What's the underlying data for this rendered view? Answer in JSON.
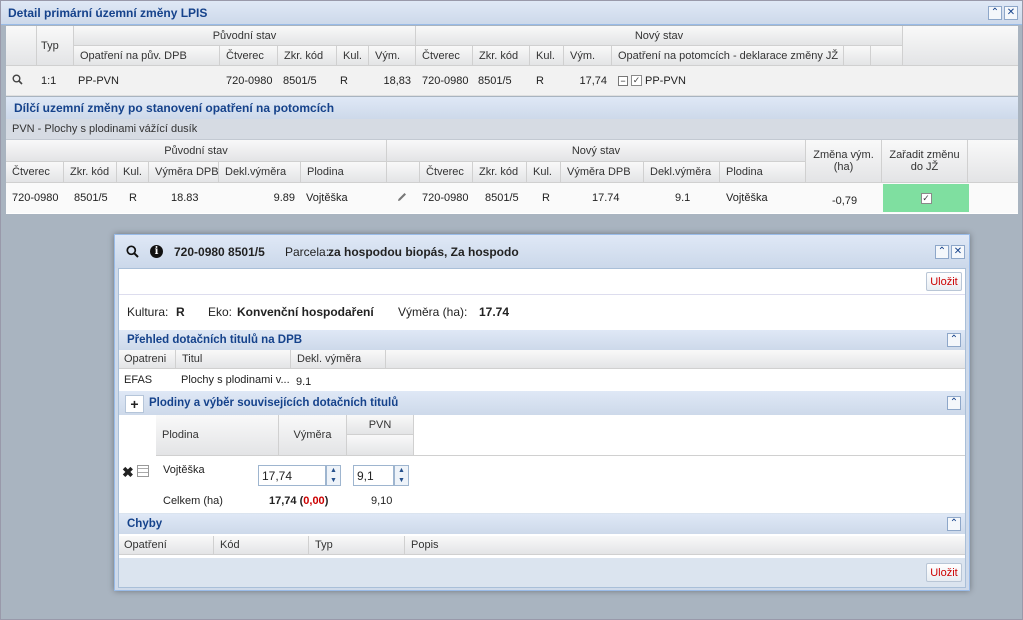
{
  "outer": {
    "title": "Detail primární územní změny LPIS",
    "top_grid": {
      "group_orig": "Původní stav",
      "group_new": "Nový stav",
      "col_typ": "Typ",
      "col_opatreni": "Opatření na pův. DPB",
      "col_ctverec": "Čtverec",
      "col_zkr": "Zkr. kód",
      "col_kul": "Kul.",
      "col_vym": "Vým.",
      "col_ctverec2": "Čtverec",
      "col_zkr2": "Zkr. kód",
      "col_kul2": "Kul.",
      "col_vym2": "Vým.",
      "col_opatreni_potomci": "Opatření na potomcích - deklarace změny JŽ",
      "row": {
        "typ": "1:1",
        "opatreni": "PP-PVN",
        "ctverec": "720-0980",
        "zkr": "8501/5",
        "kul": "R",
        "vym": "18,83",
        "ctverec2": "720-0980",
        "zkr2": "8501/5",
        "kul2": "R",
        "vym2": "17,74",
        "opatreni_potomci": "PP-PVN"
      }
    },
    "section2_title": "Dílčí uzemní změny po stanovení opatření na potomcích",
    "section2_sub": "PVN - Plochy s plodinami vážící dusík",
    "grid2": {
      "group_orig": "Původní stav",
      "group_new": "Nový stav",
      "col_ctverec": "Čtverec",
      "col_zkr": "Zkr. kód",
      "col_kul": "Kul.",
      "col_vymdpb": "Výměra DPB",
      "col_dekl": "Dekl.výměra",
      "col_plodina": "Plodina",
      "col_ctverec2": "Čtverec",
      "col_zkr2": "Zkr. kód",
      "col_kul2": "Kul.",
      "col_vymdpb2": "Výměra DPB",
      "col_dekl2": "Dekl.výměra",
      "col_plodina2": "Plodina",
      "col_zmena_1": "Změna vým.",
      "col_zmena_2": "(ha)",
      "col_zaradit_1": "Zařadit změnu",
      "col_zaradit_2": "do JŽ",
      "row": {
        "ctverec": "720-0980",
        "zkr": "8501/5",
        "kul": "R",
        "vymdpb": "18.83",
        "dekl": "9.89",
        "plodina": "Vojtěška",
        "ctverec2": "720-0980",
        "zkr2": "8501/5",
        "kul2": "R",
        "vymdpb2": "17.74",
        "dekl2": "9.1",
        "plodina2": "Vojtěška",
        "zmena": "-0,79"
      }
    }
  },
  "dialog": {
    "title_code": "720-0980 8501/5",
    "parcela_label": "Parcela:",
    "parcela_value": "za hospodou biopás, Za hospodo",
    "save_label": "Uložit",
    "kultura_label": "Kultura:",
    "kultura_value": "R",
    "eko_label": "Eko:",
    "eko_value": "Konvenční hospodaření",
    "vymera_label": "Výměra (ha):",
    "vymera_value": "17.74",
    "sec1_title": "Přehled dotačních titulů na DPB",
    "sec1_cols": {
      "opatreni": "Opatreni",
      "titul": "Titul",
      "dekl": "Dekl. výměra"
    },
    "sec1_row": {
      "opatreni": "EFAS",
      "titul": "Plochy s plodinami v...",
      "dekl": "9.1"
    },
    "sec2_title": "Plodiny a výběr souvisejících dotačních titulů",
    "sec2_cols": {
      "plodina": "Plodina",
      "vymera": "Výměra",
      "pvn": "PVN"
    },
    "sec2_row": {
      "plodina": "Vojtěška",
      "vymera": "17,74",
      "pvn": "9,1"
    },
    "sec2_total": {
      "label": "Celkem (ha)",
      "value": "17,74",
      "diff_open": "(",
      "diff": "0,00",
      "diff_close": ")",
      "pvn": "9,10"
    },
    "sec3_title": "Chyby",
    "sec3_cols": {
      "opatreni": "Opatření",
      "kod": "Kód",
      "typ": "Typ",
      "popis": "Popis"
    },
    "save_label_bottom": "Uložit"
  },
  "colors": {
    "accent": "#15428b",
    "checked_cell": "#7fdfa0",
    "error": "#cc0000"
  }
}
